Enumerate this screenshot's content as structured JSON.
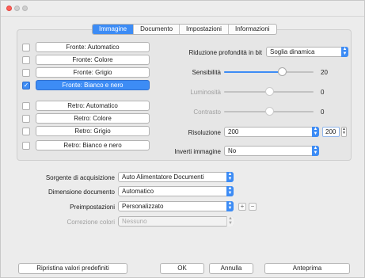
{
  "tabs": [
    "Immagine",
    "Documento",
    "Impostazioni",
    "Informazioni"
  ],
  "active_tab": "Immagine",
  "front_sides": [
    {
      "label": "Fronte: Automatico",
      "checked": false,
      "selected": false
    },
    {
      "label": "Fronte: Colore",
      "checked": false,
      "selected": false
    },
    {
      "label": "Fronte: Grigio",
      "checked": false,
      "selected": false
    },
    {
      "label": "Fronte: Bianco e nero",
      "checked": true,
      "selected": true
    }
  ],
  "back_sides": [
    {
      "label": "Retro: Automatico",
      "checked": false
    },
    {
      "label": "Retro: Colore",
      "checked": false
    },
    {
      "label": "Retro: Grigio",
      "checked": false
    },
    {
      "label": "Retro: Bianco e nero",
      "checked": false
    }
  ],
  "image": {
    "bit_depth_label": "Riduzione profondità in bit",
    "bit_depth_value": "Soglia dinamica",
    "sensitivity_label": "Sensibilità",
    "sensitivity_value": "20",
    "sensitivity_fraction": 0.65,
    "brightness_label": "Luminosità",
    "brightness_value": "0",
    "brightness_fraction": 0.5,
    "contrast_label": "Contrasto",
    "contrast_value": "0",
    "contrast_fraction": 0.5,
    "resolution_label": "Risoluzione",
    "resolution_value": "200",
    "resolution_custom": "200",
    "invert_label": "Inverti immagine",
    "invert_value": "No"
  },
  "acquisition": {
    "source_label": "Sorgente di acquisizione",
    "source_value": "Auto Alimentatore Documenti",
    "size_label": "Dimensione documento",
    "size_value": "Automatico",
    "preset_label": "Preimpostazioni",
    "preset_value": "Personalizzato",
    "color_correction_label": "Correzione colori",
    "color_correction_value": "Nessuno"
  },
  "buttons": {
    "restore": "Ripristina valori predefiniti",
    "ok": "OK",
    "cancel": "Annulla",
    "preview": "Anteprima"
  },
  "colors": {
    "accent": "#3d8cf5",
    "close": "#ff5f57"
  }
}
